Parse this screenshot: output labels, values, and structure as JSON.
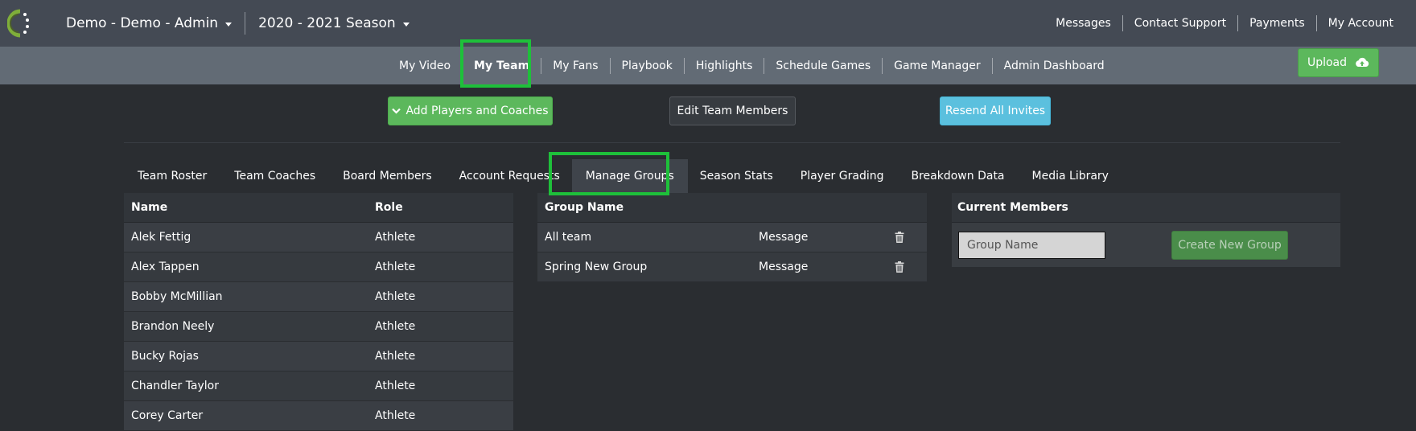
{
  "topbar": {
    "team_dropdown": "Demo - Demo - Admin",
    "season_dropdown": "2020 - 2021 Season",
    "links": [
      "Messages",
      "Contact Support",
      "Payments",
      "My Account"
    ]
  },
  "subnav": {
    "items": [
      "My Video",
      "My Team",
      "My Fans",
      "Playbook",
      "Highlights",
      "Schedule Games",
      "Game Manager",
      "Admin Dashboard"
    ],
    "active": "My Team",
    "upload_label": "Upload"
  },
  "actions": {
    "add_label": "Add Players and Coaches",
    "edit_label": "Edit Team Members",
    "resend_label": "Resend All Invites"
  },
  "tabs": {
    "items": [
      "Team Roster",
      "Team Coaches",
      "Board Members",
      "Account Requests",
      "Manage Groups",
      "Season Stats",
      "Player Grading",
      "Breakdown Data",
      "Media Library"
    ],
    "active": "Manage Groups"
  },
  "roster": {
    "headers": {
      "name": "Name",
      "role": "Role"
    },
    "rows": [
      {
        "name": "Alek Fettig",
        "role": "Athlete"
      },
      {
        "name": "Alex Tappen",
        "role": "Athlete"
      },
      {
        "name": "Bobby McMillian",
        "role": "Athlete"
      },
      {
        "name": "Brandon Neely",
        "role": "Athlete"
      },
      {
        "name": "Bucky Rojas",
        "role": "Athlete"
      },
      {
        "name": "Chandler Taylor",
        "role": "Athlete"
      },
      {
        "name": "Corey Carter",
        "role": "Athlete"
      }
    ]
  },
  "groups": {
    "header": "Group Name",
    "rows": [
      {
        "name": "All team",
        "action": "Message"
      },
      {
        "name": "Spring New Group",
        "action": "Message"
      }
    ]
  },
  "members": {
    "header": "Current Members",
    "input_placeholder": "Group Name",
    "create_label": "Create New Group"
  },
  "colors": {
    "topbar_bg": "#444a54",
    "subnav_bg": "#626b75",
    "page_bg": "#2a2d31",
    "success": "#5cb85c",
    "info": "#5bc0de",
    "highlight": "#1ec03a"
  },
  "icons": {
    "logo": "app-logo",
    "upload": "cloud-upload-icon",
    "add_chevron": "chevron-down-icon",
    "delete": "trash-icon"
  }
}
